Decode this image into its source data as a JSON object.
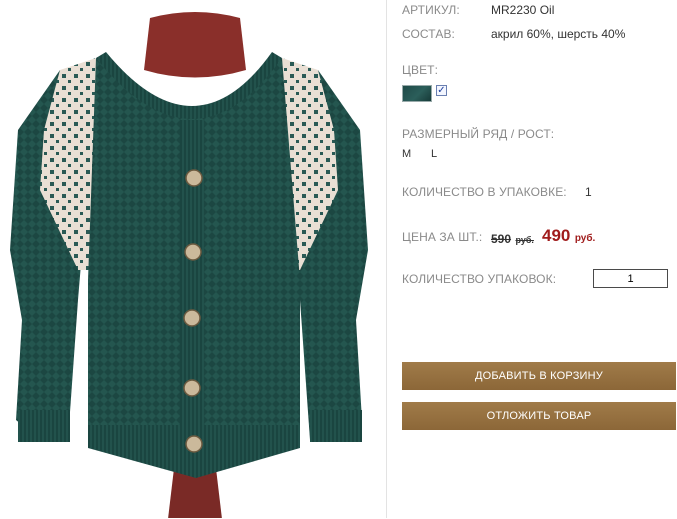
{
  "product": {
    "sku_label": "АРТИКУЛ:",
    "sku_value": "MR2230 Oil",
    "composition_label": "СОСТАВ:",
    "composition_value": "акрил 60%, шерсть 40%",
    "color_label": "ЦВЕТ:",
    "color_swatch": "#1f4a48",
    "color_checked_mark": "✓",
    "sizes_label": "РАЗМЕРНЫЙ РЯД / РОСТ:",
    "sizes": [
      "M",
      "L"
    ],
    "pack_qty_label": "КОЛИЧЕСТВО В УПАКОВКЕ:",
    "pack_qty_value": "1",
    "price_label": "ЦЕНА ЗА ШТ.:",
    "old_price": "590",
    "old_price_currency": "руб.",
    "new_price": "490",
    "new_price_currency": "руб.",
    "packs_label": "КОЛИЧЕСТВО УПАКОВОК:",
    "packs_value": "1"
  },
  "actions": {
    "add_to_cart": "ДОБАВИТЬ В КОРЗИНУ",
    "postpone": "ОТЛОЖИТЬ ТОВАР"
  },
  "colors": {
    "button_bg": "#94703f",
    "price_red": "#a01c1c",
    "sweater_green": "#255a56"
  }
}
